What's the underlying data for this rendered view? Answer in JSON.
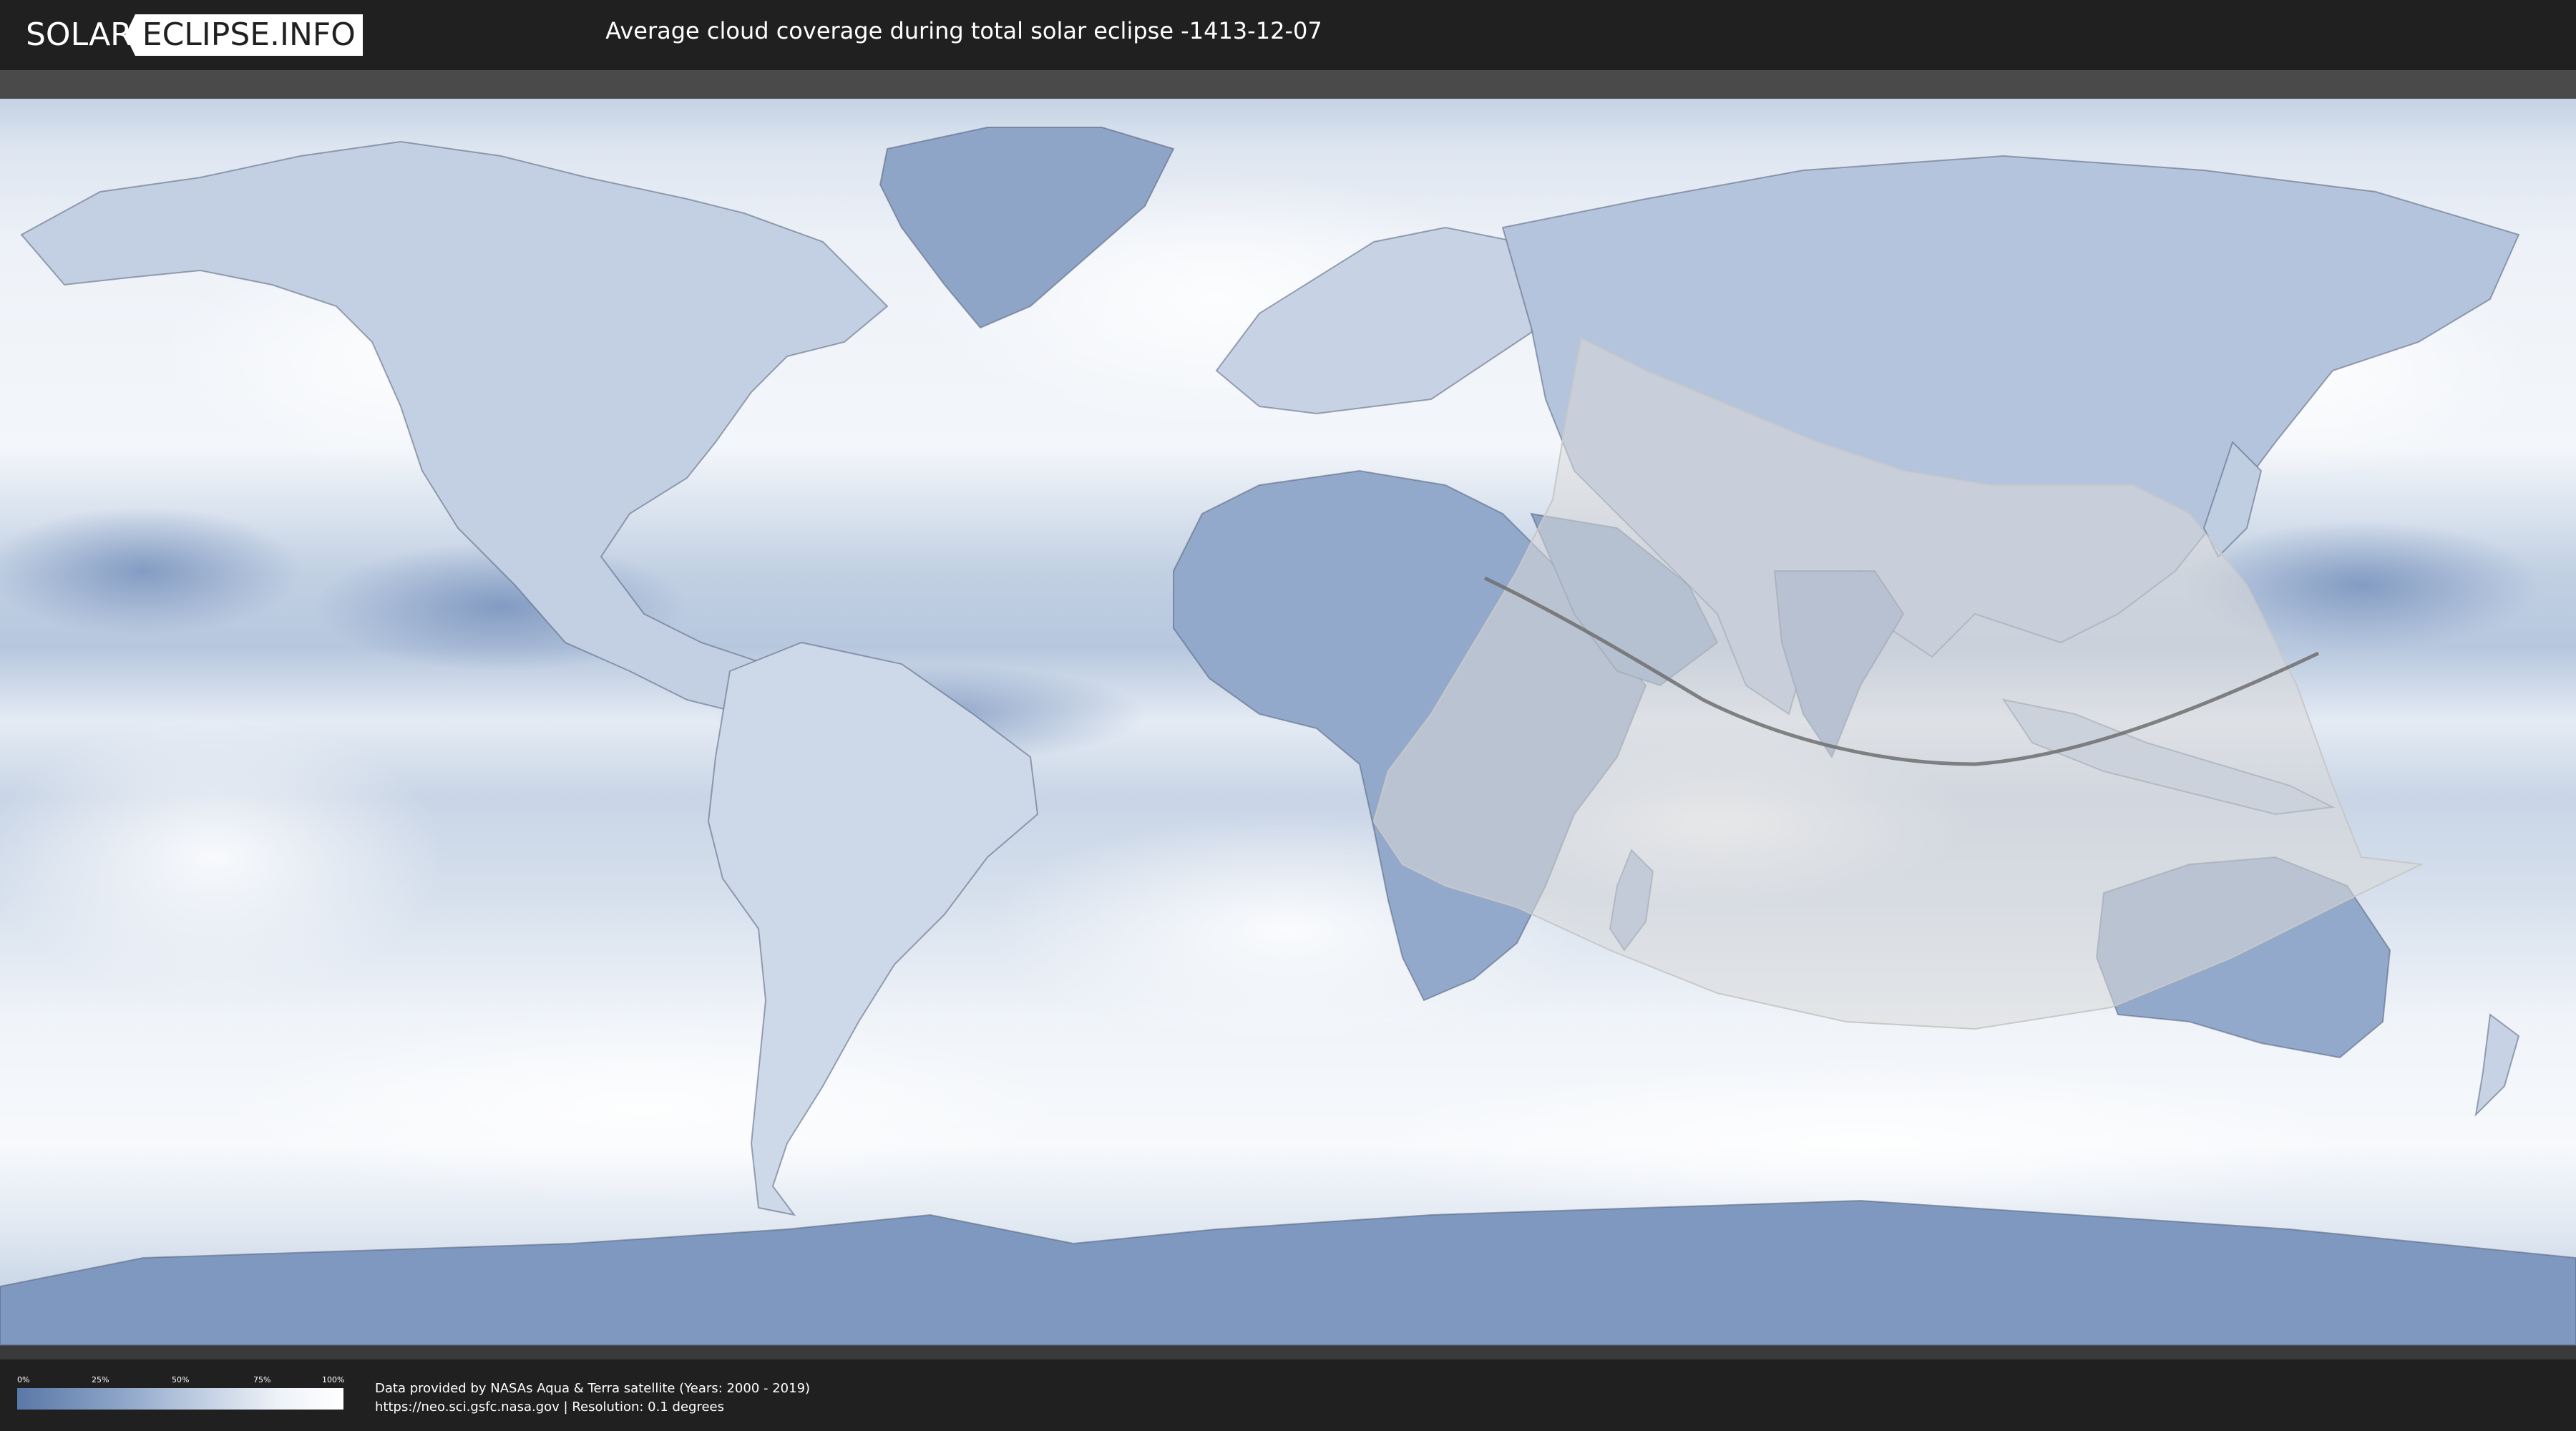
{
  "header": {
    "logo_left": "SOLAR",
    "logo_right": "ECLIPSE.INFO",
    "title": "Average cloud coverage during total solar eclipse -1413-12-07"
  },
  "legend": {
    "ticks": [
      "0%",
      "25%",
      "50%",
      "75%",
      "100%"
    ],
    "gradient_colors": [
      "#5a78a8",
      "#8aa2c6",
      "#c7d4e6",
      "#eef2f8",
      "#ffffff"
    ]
  },
  "footer": {
    "credit_line_1": "Data provided by NASAs Aqua & Terra satellite (Years: 2000 - 2019)",
    "credit_line_2": "https://neo.sci.gsfc.nasa.gov | Resolution: 0.1 degrees"
  },
  "colors": {
    "background": "#202020",
    "land_cloud_low": "#6a86b4",
    "cloud_high": "#f4f7fb",
    "visibility_zone": "#d8d8d8",
    "central_line": "#707070"
  }
}
